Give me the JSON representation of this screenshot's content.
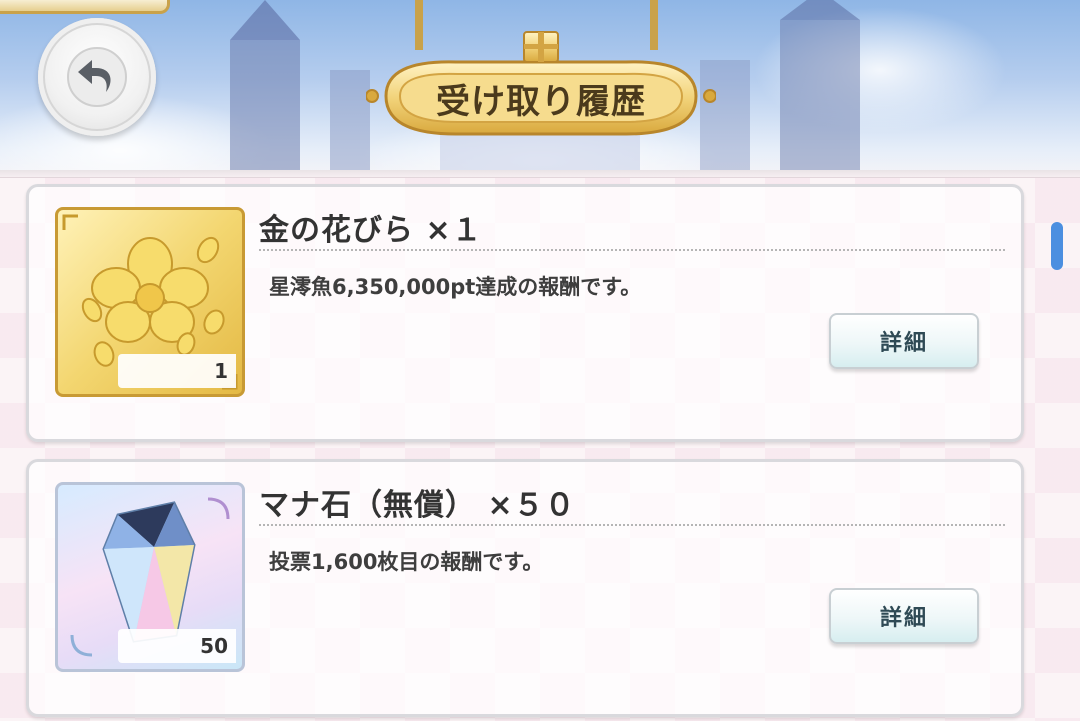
{
  "header": {
    "title": "受け取り履歴",
    "back_button_icon": "back-arrow-icon"
  },
  "history": [
    {
      "name": "金の花びら ×１",
      "description": "星澪魚6,350,000pt達成の報酬です。",
      "quantity": "1",
      "icon": "gold-petal-icon",
      "detail_label": "詳細"
    },
    {
      "name": "マナ石（無償） ×５０",
      "description": "投票1,600枚目の報酬です。",
      "quantity": "50",
      "icon": "mana-stone-icon",
      "detail_label": "詳細"
    }
  ],
  "colors": {
    "accent_gold": "#c89a34",
    "scrollbar": "#4b8fe0",
    "detail_text": "#2f4a55"
  }
}
